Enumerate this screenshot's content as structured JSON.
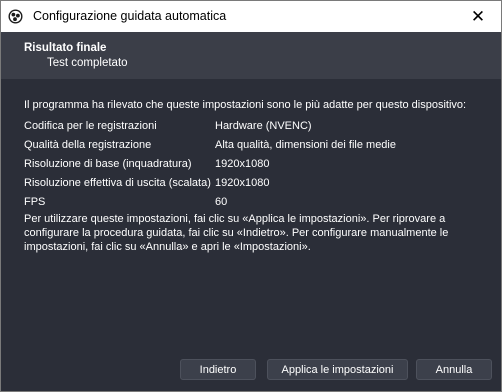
{
  "window": {
    "title": "Configurazione guidata automatica",
    "close_glyph": "✕"
  },
  "header": {
    "title": "Risultato finale",
    "subtitle": "Test completato"
  },
  "content": {
    "intro": "Il programma ha rilevato che queste impostazioni sono le più adatte per questo dispositivo:",
    "settings": [
      {
        "label": "Codifica per le registrazioni",
        "value": "Hardware (NVENC)"
      },
      {
        "label": "Qualità della registrazione",
        "value": "Alta qualità, dimensioni dei file medie"
      },
      {
        "label": "Risoluzione di base (inquadratura)",
        "value": "1920x1080"
      },
      {
        "label": "Risoluzione effettiva di uscita (scalata)",
        "value": "1920x1080"
      },
      {
        "label": "FPS",
        "value": "60"
      }
    ],
    "note": "Per utilizzare queste impostazioni, fai clic su «Applica le impostazioni». Per riprovare a configurare la procedura guidata, fai clic su «Indietro». Per configurare manualmente le impostazioni, fai clic su «Annulla» e apri le «Impostazioni»."
  },
  "buttons": {
    "back": "Indietro",
    "apply": "Applica le impostazioni",
    "cancel": "Annulla"
  },
  "icons": {
    "app": "obs-logo-icon",
    "close": "close-icon"
  }
}
